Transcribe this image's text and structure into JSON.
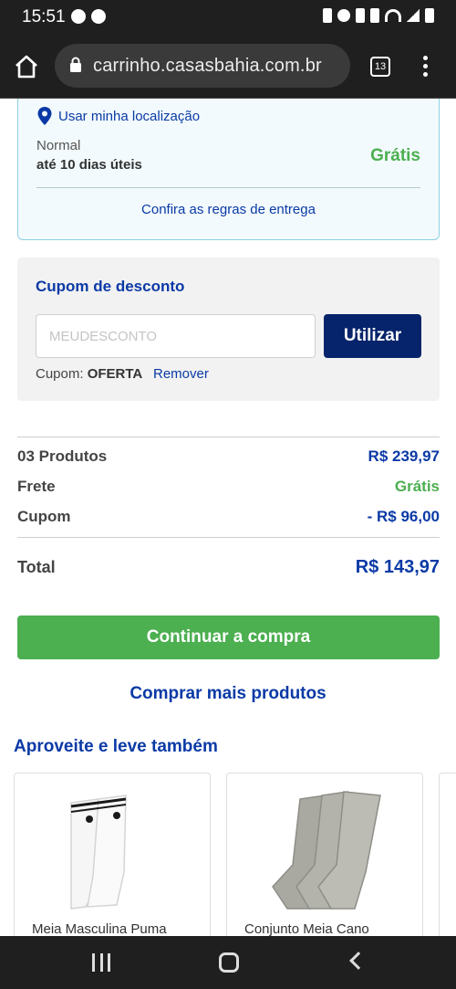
{
  "status_bar": {
    "time": "15:51"
  },
  "browser": {
    "url": "carrinho.casasbahia.com.br",
    "tab_count": "13"
  },
  "delivery": {
    "use_location_label": "Usar minha localização",
    "shipping_type": "Normal",
    "shipping_time": "até 10 dias úteis",
    "shipping_price": "Grátis",
    "rules_link": "Confira as regras de entrega"
  },
  "coupon": {
    "title": "Cupom de desconto",
    "placeholder": "MEUDESCONTO",
    "apply_label": "Utilizar",
    "applied_prefix": "Cupom:",
    "applied_code": "OFERTA",
    "remove_label": "Remover"
  },
  "summary": {
    "products_label": "03 Produtos",
    "products_value": "R$ 239,97",
    "shipping_label": "Frete",
    "shipping_value": "Grátis",
    "coupon_label": "Cupom",
    "coupon_value": "- R$ 96,00",
    "total_label": "Total",
    "total_value": "R$ 143,97"
  },
  "actions": {
    "continue_label": "Continuar a compra",
    "more_products_label": "Comprar mais produtos"
  },
  "recommendations": {
    "title": "Aproveite e leve também",
    "products": [
      {
        "name": "Meia Masculina Puma"
      },
      {
        "name": "Conjunto Meia Cano"
      }
    ]
  },
  "colors": {
    "brand_blue": "#0b3aa6",
    "dark_blue": "#06246b",
    "green": "#4caf50"
  }
}
